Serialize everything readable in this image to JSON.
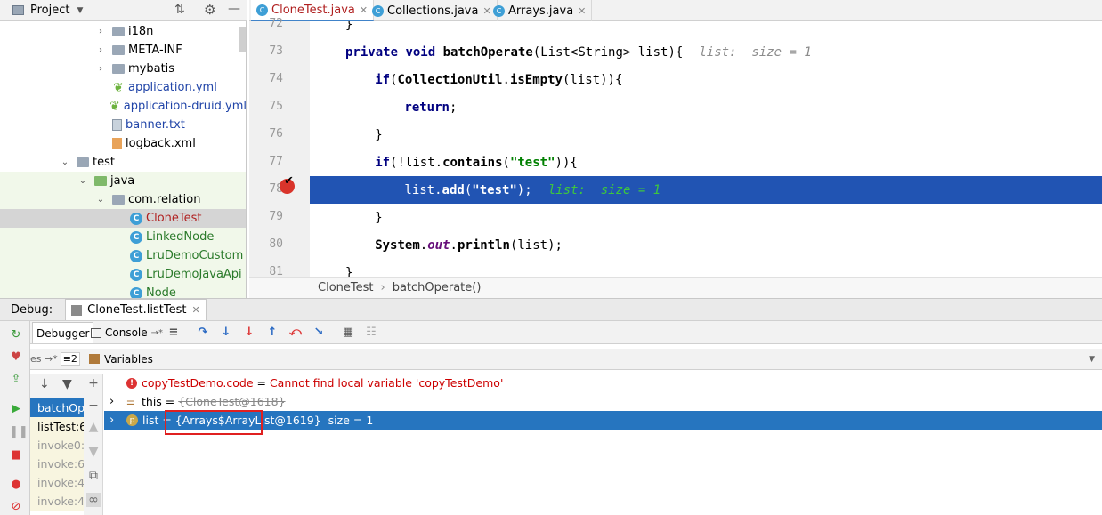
{
  "project": {
    "title": "Project",
    "tree": [
      {
        "label": "i18n",
        "type": "folder",
        "indent": 1,
        "arrow": "›"
      },
      {
        "label": "META-INF",
        "type": "folder",
        "indent": 1,
        "arrow": "›"
      },
      {
        "label": "mybatis",
        "type": "folder",
        "indent": 1,
        "arrow": "›"
      },
      {
        "label": "application.yml",
        "type": "spring",
        "indent": 1,
        "arrow": ""
      },
      {
        "label": "application-druid.yml",
        "type": "spring",
        "indent": 1,
        "arrow": ""
      },
      {
        "label": "banner.txt",
        "type": "file",
        "indent": 1,
        "arrow": ""
      },
      {
        "label": "logback.xml",
        "type": "xml",
        "indent": 1,
        "arrow": ""
      },
      {
        "label": "test",
        "type": "folder",
        "indent": 0,
        "arrow": "⌄"
      },
      {
        "label": "java",
        "type": "folder-green",
        "indent": 0.5,
        "arrow": "⌄"
      },
      {
        "label": "com.relation",
        "type": "folder",
        "indent": 1,
        "arrow": "⌄"
      },
      {
        "label": "CloneTest",
        "type": "class",
        "indent": 2,
        "arrow": ""
      },
      {
        "label": "LinkedNode",
        "type": "class",
        "indent": 2,
        "arrow": ""
      },
      {
        "label": "LruDemoCustom",
        "type": "class",
        "indent": 2,
        "arrow": ""
      },
      {
        "label": "LruDemoJavaApi",
        "type": "class",
        "indent": 2,
        "arrow": ""
      },
      {
        "label": "Node",
        "type": "class",
        "indent": 2,
        "arrow": ""
      }
    ]
  },
  "tabs": [
    {
      "label": "CloneTest.java",
      "icon": "C",
      "active": true
    },
    {
      "label": "Collections.java",
      "icon": "C",
      "active": false
    },
    {
      "label": "Arrays.java",
      "icon": "C",
      "active": false
    }
  ],
  "code": {
    "lines": [
      {
        "num": "72",
        "text": "}"
      },
      {
        "num": "73",
        "text": "private void batchOperate(List<String> list){",
        "hint": "list:  size = 1"
      },
      {
        "num": "74",
        "text": "    if(CollectionUtil.isEmpty(list)){"
      },
      {
        "num": "75",
        "text": "        return;"
      },
      {
        "num": "76",
        "text": "    }"
      },
      {
        "num": "77",
        "text": "    if(!list.contains(\"test\")){"
      },
      {
        "num": "78",
        "text": "        list.add(\"test\");",
        "hint": "list:  size = 1"
      },
      {
        "num": "79",
        "text": "    }"
      },
      {
        "num": "80",
        "text": "    System.out.println(list);"
      },
      {
        "num": "81",
        "text": "}"
      }
    ]
  },
  "breadcrumb": {
    "class": "CloneTest",
    "sep": "›",
    "method": "batchOperate()"
  },
  "debug": {
    "title": "Debug:",
    "session": "CloneTest.listTest",
    "tab_debugger": "Debugger",
    "tab_console": "Console",
    "tab_console_arrow": "→*",
    "frames_head_left": "es →*",
    "frames_head_right": "≡2",
    "variables_label": "Variables",
    "frames": [
      {
        "label": "batchOpe",
        "style": "sel"
      },
      {
        "label": "listTest:6",
        "style": "y"
      },
      {
        "label": "invoke0:",
        "style": "gray"
      },
      {
        "label": "invoke:6",
        "style": "gray"
      },
      {
        "label": "invoke:4",
        "style": "gray"
      },
      {
        "label": "invoke:4",
        "style": "gray"
      }
    ],
    "variables": [
      {
        "name": "copyTestDemo.code",
        "eq": " = ",
        "value": "Cannot find local variable 'copyTestDemo'",
        "kind": "error"
      },
      {
        "name": "this",
        "eq": " = ",
        "value": "{CloneTest@1618}",
        "kind": "this"
      },
      {
        "name": "list",
        "eq": " = ",
        "value": "{Arrays$ArrayList@1619}",
        "extra": "size = 1",
        "kind": "list"
      }
    ]
  }
}
